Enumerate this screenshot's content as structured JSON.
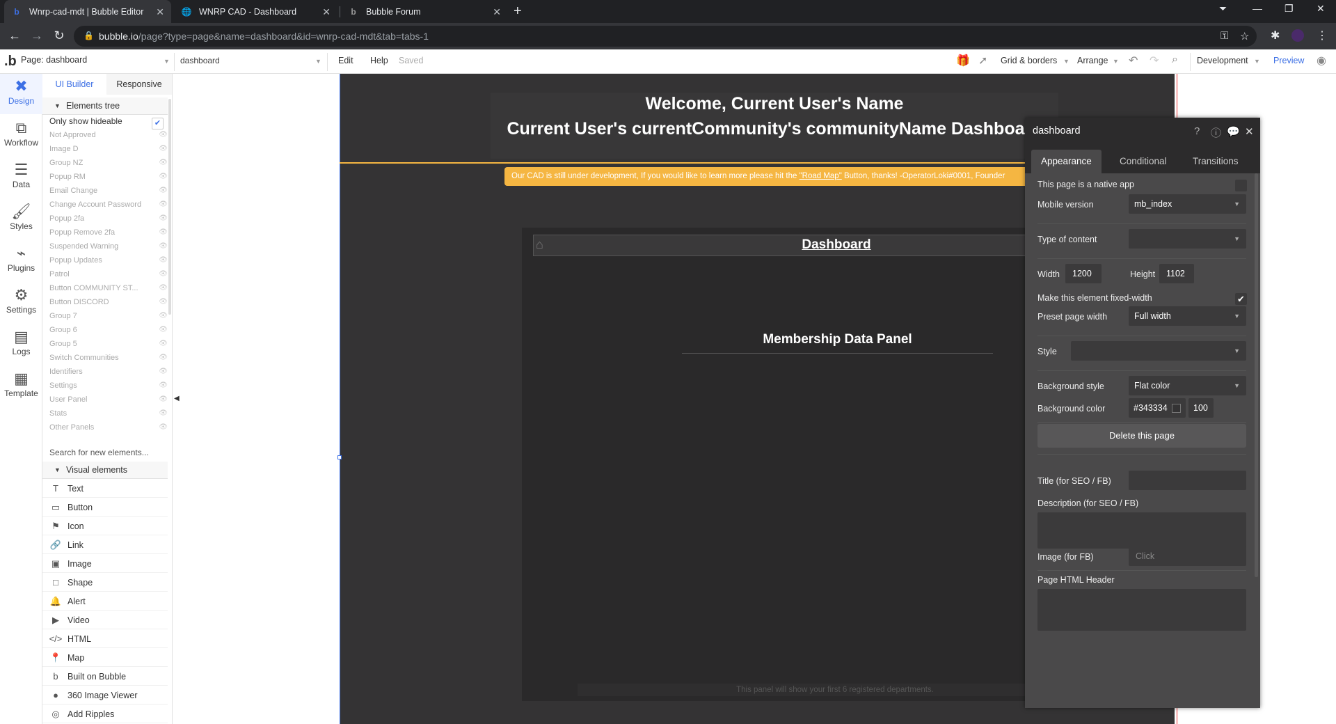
{
  "browser": {
    "tabs": [
      {
        "title": "Wnrp-cad-mdt | Bubble Editor",
        "icon": "bubble-icon"
      },
      {
        "title": "WNRP CAD - Dashboard",
        "icon": "globe-icon"
      },
      {
        "title": "Bubble Forum",
        "icon": "bubble-icon"
      }
    ],
    "url_host": "bubble.io",
    "url_path": "/page?type=page&name=dashboard&id=wnrp-cad-mdt&tab=tabs-1"
  },
  "topbar": {
    "page_label": "Page: dashboard",
    "element_select": "dashboard",
    "edit": "Edit",
    "help": "Help",
    "saved": "Saved",
    "grid": "Grid & borders",
    "arrange": "Arrange",
    "environment": "Development",
    "preview": "Preview"
  },
  "rail": {
    "design": "Design",
    "workflow": "Workflow",
    "data": "Data",
    "styles": "Styles",
    "plugins": "Plugins",
    "settings": "Settings",
    "logs": "Logs",
    "template": "Template"
  },
  "left_panel": {
    "tab_ui": "UI Builder",
    "tab_responsive": "Responsive",
    "elements_tree": "Elements tree",
    "only_hideable": "Only show hideable",
    "tree_items": [
      "Not Approved",
      "Image D",
      "Group NZ",
      "Popup RM",
      "Email Change",
      "Change Account Password",
      "Popup 2fa",
      "Popup Remove 2fa",
      "Suspended Warning",
      "Popup Updates",
      "Patrol",
      "Button COMMUNITY ST...",
      "Button DISCORD",
      "Group 7",
      "Group 6",
      "Group 5",
      "Switch Communities",
      "Identifiers",
      "Settings",
      "User Panel",
      "Stats",
      "Other Panels"
    ],
    "search_placeholder": "Search for new elements...",
    "visual_elements": "Visual elements",
    "visual_items": [
      {
        "label": "Text",
        "icon": "T"
      },
      {
        "label": "Button",
        "icon": "▭"
      },
      {
        "label": "Icon",
        "icon": "⚑"
      },
      {
        "label": "Link",
        "icon": "🔗"
      },
      {
        "label": "Image",
        "icon": "▣"
      },
      {
        "label": "Shape",
        "icon": "□"
      },
      {
        "label": "Alert",
        "icon": "🔔"
      },
      {
        "label": "Video",
        "icon": "▶"
      },
      {
        "label": "HTML",
        "icon": "</>"
      },
      {
        "label": "Map",
        "icon": "📍"
      },
      {
        "label": "Built on Bubble",
        "icon": "b"
      },
      {
        "label": "360 Image Viewer",
        "icon": "●"
      },
      {
        "label": "Add Ripples",
        "icon": "◎"
      }
    ]
  },
  "canvas": {
    "welcome_line1": "Welcome, Current User's Name",
    "welcome_line2": "Current User's currentCommunity's communityName Dashboard",
    "banner_text": "Our CAD is still under development, If you would like to learn more please hit the ",
    "banner_link": "\"Road Map\"",
    "banner_tail": " Button, thanks! -OperatorLoki#0001, Founder",
    "dashboard_title": "Dashboard",
    "membership_title": "Membership Data Panel",
    "footnote": "This panel will show your first 6 registered departments.",
    "page_bg_color": "#343334",
    "accent_color": "#f5b642"
  },
  "property_editor": {
    "title": "dashboard",
    "tabs": [
      "Appearance",
      "Conditional",
      "Transitions"
    ],
    "native_app_label": "This page is a native app",
    "mobile_version_label": "Mobile version",
    "mobile_version_value": "mb_index",
    "type_of_content_label": "Type of content",
    "type_of_content_value": "",
    "width_label": "Width",
    "width_value": "1200",
    "height_label": "Height",
    "height_value": "1102",
    "fixed_width_label": "Make this element fixed-width",
    "fixed_width_checked": "✔",
    "preset_width_label": "Preset page width",
    "preset_width_value": "Full width",
    "style_label": "Style",
    "style_value": "",
    "bg_style_label": "Background style",
    "bg_style_value": "Flat color",
    "bg_color_label": "Background color",
    "bg_color_value": "#343334",
    "bg_opacity": "100",
    "delete_button": "Delete this page",
    "seo_title_label": "Title (for SEO / FB)",
    "seo_desc_label": "Description (for SEO / FB)",
    "image_fb_label": "Image (for FB)",
    "image_fb_placeholder": "Click",
    "html_header_label": "Page HTML Header"
  }
}
